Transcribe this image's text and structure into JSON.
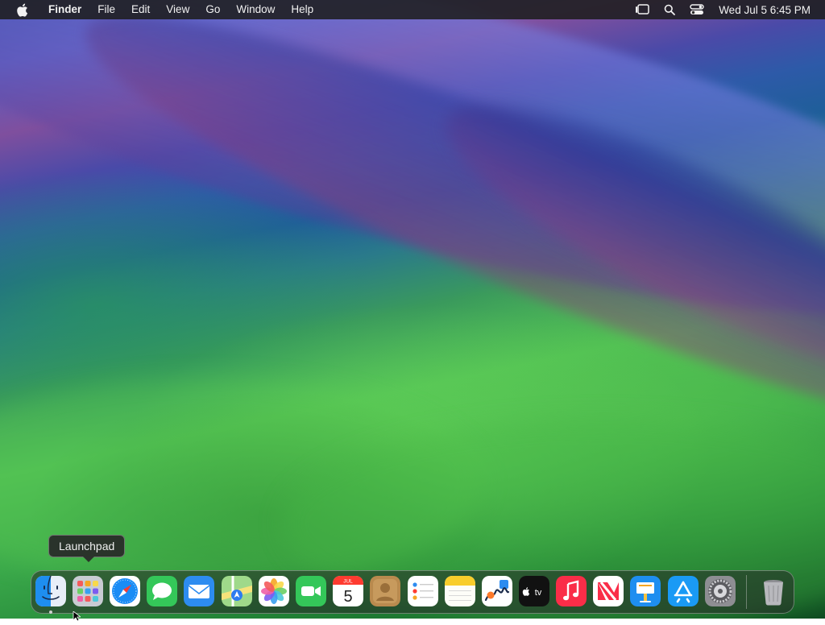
{
  "menubar": {
    "app_name": "Finder",
    "menus": [
      "File",
      "Edit",
      "View",
      "Go",
      "Window",
      "Help"
    ],
    "clock": "Wed Jul 5  6:45 PM",
    "icons": [
      "stage-manager-icon",
      "spotlight-search-icon",
      "control-center-icon"
    ]
  },
  "tooltip": {
    "text": "Launchpad"
  },
  "dock": {
    "apps": [
      {
        "name": "Finder",
        "icon": "finder-icon",
        "running": true
      },
      {
        "name": "Launchpad",
        "icon": "launchpad-icon",
        "running": false
      },
      {
        "name": "Safari",
        "icon": "safari-icon",
        "running": false
      },
      {
        "name": "Messages",
        "icon": "messages-icon",
        "running": false
      },
      {
        "name": "Mail",
        "icon": "mail-icon",
        "running": false
      },
      {
        "name": "Maps",
        "icon": "maps-icon",
        "running": false
      },
      {
        "name": "Photos",
        "icon": "photos-icon",
        "running": false
      },
      {
        "name": "FaceTime",
        "icon": "facetime-icon",
        "running": false
      },
      {
        "name": "Calendar",
        "icon": "calendar-icon",
        "running": false
      },
      {
        "name": "Contacts",
        "icon": "contacts-icon",
        "running": false
      },
      {
        "name": "Reminders",
        "icon": "reminders-icon",
        "running": false
      },
      {
        "name": "Notes",
        "icon": "notes-icon",
        "running": false
      },
      {
        "name": "Freeform",
        "icon": "freeform-icon",
        "running": false
      },
      {
        "name": "TV",
        "icon": "apple-tv-icon",
        "running": false
      },
      {
        "name": "Music",
        "icon": "music-icon",
        "running": false
      },
      {
        "name": "News",
        "icon": "news-icon",
        "running": false
      },
      {
        "name": "Keynote",
        "icon": "keynote-icon",
        "running": false
      },
      {
        "name": "App Store",
        "icon": "app-store-icon",
        "running": false
      },
      {
        "name": "System Settings",
        "icon": "system-settings-icon",
        "running": false
      },
      {
        "name": "Trash",
        "icon": "trash-icon",
        "running": false
      }
    ],
    "calendar": {
      "month": "JUL",
      "day": "5"
    },
    "tv_label": "tv"
  }
}
